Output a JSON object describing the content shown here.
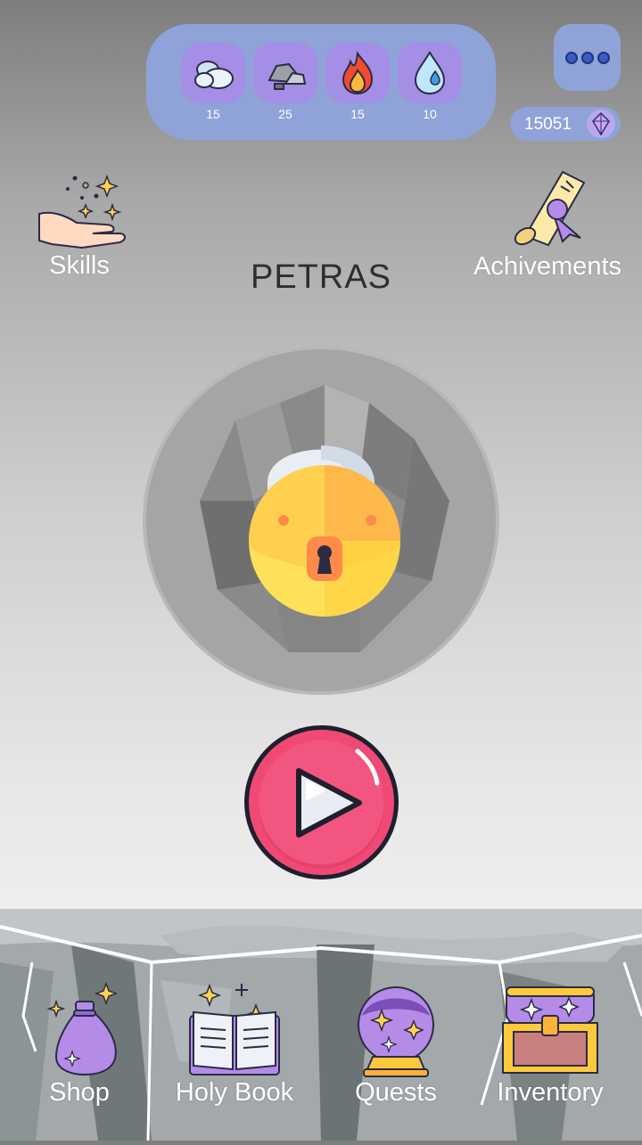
{
  "resources": [
    {
      "icon": "cloud-icon",
      "count": "15"
    },
    {
      "icon": "rock-icon",
      "count": "25"
    },
    {
      "icon": "fire-icon",
      "count": "15"
    },
    {
      "icon": "water-drop-icon",
      "count": "10"
    }
  ],
  "currency": {
    "value": "15051",
    "icon": "crystal-gem-icon"
  },
  "menu": {
    "icon": "more-dots-icon"
  },
  "top_nav": {
    "skills_label": "Skills",
    "achievements_label": "Achivements"
  },
  "level": {
    "title": "PETRAS",
    "locked": true,
    "icons": [
      "stone-island-icon",
      "padlock-icon"
    ]
  },
  "play": {
    "icon": "play-icon"
  },
  "bottom_nav": {
    "shop_label": "Shop",
    "holy_book_label": "Holy Book",
    "quests_label": "Quests",
    "inventory_label": "Inventory"
  },
  "colors": {
    "panel": "#8fa3d9",
    "tile": "#a48ee6",
    "play": "#f04a74",
    "lock_gold": "#ffc93c"
  }
}
